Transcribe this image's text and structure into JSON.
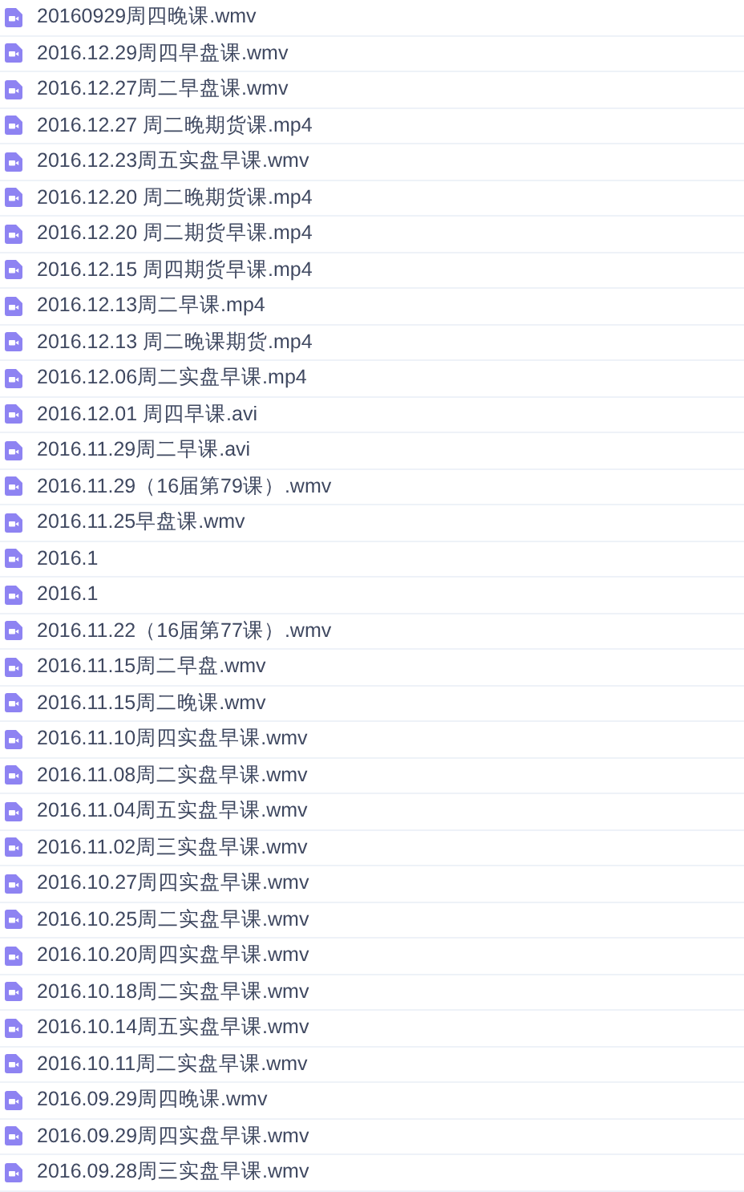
{
  "files": [
    {
      "name": "20160929周四晚课.wmv"
    },
    {
      "name": "2016.12.29周四早盘课.wmv"
    },
    {
      "name": "2016.12.27周二早盘课.wmv"
    },
    {
      "name": "2016.12.27 周二晚期货课.mp4"
    },
    {
      "name": "2016.12.23周五实盘早课.wmv"
    },
    {
      "name": "2016.12.20 周二晚期货课.mp4"
    },
    {
      "name": "2016.12.20 周二期货早课.mp4"
    },
    {
      "name": "2016.12.15 周四期货早课.mp4"
    },
    {
      "name": "2016.12.13周二早课.mp4"
    },
    {
      "name": "2016.12.13 周二晚课期货.mp4"
    },
    {
      "name": "2016.12.06周二实盘早课.mp4"
    },
    {
      "name": "2016.12.01 周四早课.avi"
    },
    {
      "name": "2016.11.29周二早课.avi"
    },
    {
      "name": "2016.11.29（16届第79课）.wmv"
    },
    {
      "name": "2016.11.25早盘课.wmv"
    },
    {
      "name": "2016.1"
    },
    {
      "name": "2016.1"
    },
    {
      "name": "2016.11.22（16届第77课）.wmv"
    },
    {
      "name": "2016.11.15周二早盘.wmv"
    },
    {
      "name": "2016.11.15周二晚课.wmv"
    },
    {
      "name": "2016.11.10周四实盘早课.wmv"
    },
    {
      "name": "2016.11.08周二实盘早课.wmv"
    },
    {
      "name": "2016.11.04周五实盘早课.wmv"
    },
    {
      "name": "2016.11.02周三实盘早课.wmv"
    },
    {
      "name": "2016.10.27周四实盘早课.wmv"
    },
    {
      "name": "2016.10.25周二实盘早课.wmv"
    },
    {
      "name": "2016.10.20周四实盘早课.wmv"
    },
    {
      "name": "2016.10.18周二实盘早课.wmv"
    },
    {
      "name": "2016.10.14周五实盘早课.wmv"
    },
    {
      "name": "2016.10.11周二实盘早课.wmv"
    },
    {
      "name": "2016.09.29周四晚课.wmv"
    },
    {
      "name": "2016.09.29周四实盘早课.wmv"
    },
    {
      "name": "2016.09.28周三实盘早课.wmv"
    }
  ]
}
